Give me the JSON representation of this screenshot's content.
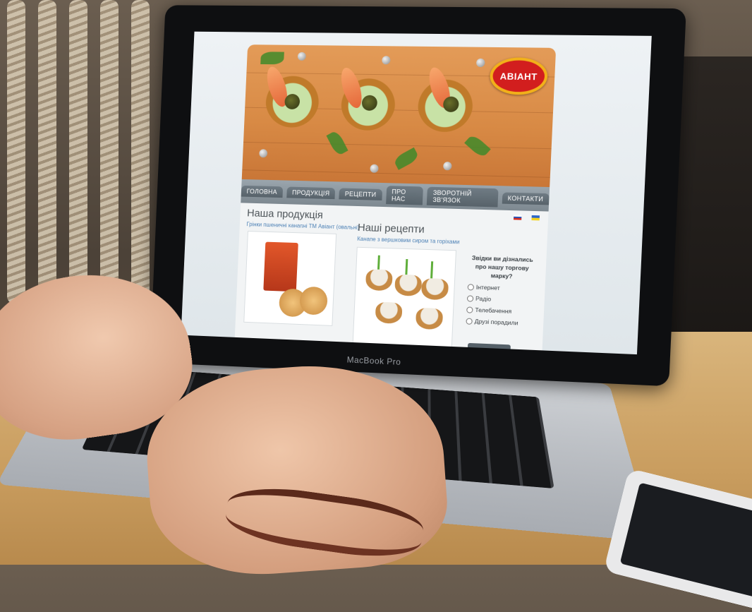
{
  "laptop": {
    "brand_label": "MacBook Pro"
  },
  "site": {
    "logo_text": "АВІАНТ",
    "nav": [
      {
        "label": "ГОЛОВНА"
      },
      {
        "label": "ПРОДУКЦІЯ"
      },
      {
        "label": "РЕЦЕПТИ"
      },
      {
        "label": "ПРО НАС"
      },
      {
        "label": "ЗВОРОТНІЙ ЗВ'ЯЗОК"
      },
      {
        "label": "КОНТАКТИ"
      }
    ],
    "products": {
      "title": "Наша продукція",
      "subtitle": "Грінки пшеничні канапні ТМ Авіант (овальні)"
    },
    "recipes": {
      "title": "Наші рецепти",
      "subtitle": "Канапе з вершковим сиром та горіхами"
    },
    "languages": [
      "ru-flag",
      "ua-flag"
    ],
    "poll": {
      "question": "Звідки ви дізнались про нашу торгову марку?",
      "options": [
        "Інтернет",
        "Радіо",
        "Телебачення",
        "Друзі порадили"
      ]
    }
  }
}
